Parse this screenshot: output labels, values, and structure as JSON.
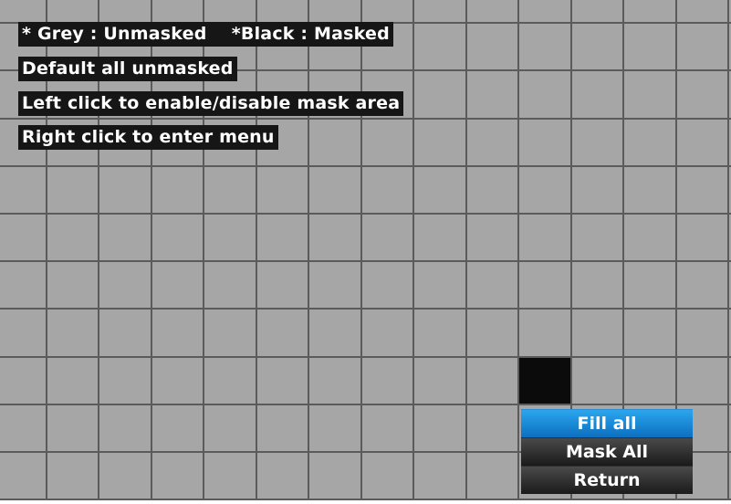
{
  "grid": {
    "columns": 14,
    "rows": 10,
    "colors": {
      "unmasked": "#a6a6a6",
      "masked": "#0b0b0b",
      "line": "#5b5b5b"
    },
    "masked_cells": [
      [
        8,
        10
      ]
    ]
  },
  "instructions": {
    "line1": "* Grey : Unmasked    *Black : Masked",
    "line2": "Default all unmasked",
    "line3": "Left click to enable/disable mask area",
    "line4": "Right click to enter menu"
  },
  "menu": {
    "items": [
      {
        "label": "Fill all",
        "selected": true
      },
      {
        "label": "Mask All",
        "selected": false
      },
      {
        "label": "Return",
        "selected": false
      }
    ],
    "selected_color": "#1e8fe0"
  }
}
